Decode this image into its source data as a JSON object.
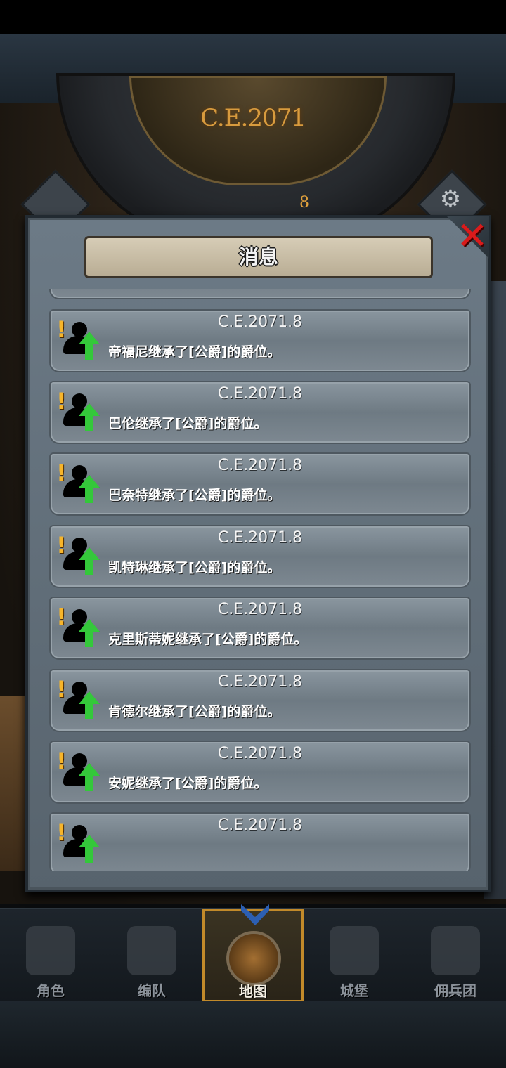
{
  "header": {
    "year": "C.E.2071",
    "month": "8"
  },
  "dialog": {
    "title": "消息",
    "close_label": "✕",
    "messages": [
      {
        "date": "C.E.2071.8",
        "text": "凯特琳继承了[公爵]的爵位。"
      },
      {
        "date": "C.E.2071.8",
        "text": "帝福尼继承了[公爵]的爵位。"
      },
      {
        "date": "C.E.2071.8",
        "text": "巴伦继承了[公爵]的爵位。"
      },
      {
        "date": "C.E.2071.8",
        "text": "巴奈特继承了[公爵]的爵位。"
      },
      {
        "date": "C.E.2071.8",
        "text": "凯特琳继承了[公爵]的爵位。"
      },
      {
        "date": "C.E.2071.8",
        "text": "克里斯蒂妮继承了[公爵]的爵位。"
      },
      {
        "date": "C.E.2071.8",
        "text": "肯德尔继承了[公爵]的爵位。"
      },
      {
        "date": "C.E.2071.8",
        "text": "安妮继承了[公爵]的爵位。"
      },
      {
        "date": "C.E.2071.8",
        "text": ""
      }
    ]
  },
  "nav": {
    "items": [
      {
        "label": "角色",
        "icon": "knight-icon"
      },
      {
        "label": "编队",
        "icon": "helmet-icon"
      },
      {
        "label": "地图",
        "icon": "map-icon",
        "active": true
      },
      {
        "label": "城堡",
        "icon": "castle-icon"
      },
      {
        "label": "佣兵团",
        "icon": "mercenary-icon"
      }
    ]
  },
  "colors": {
    "accent": "#c28a2a",
    "warning": "#f7b52a",
    "success": "#34c83a",
    "close": "#d91b1b"
  }
}
